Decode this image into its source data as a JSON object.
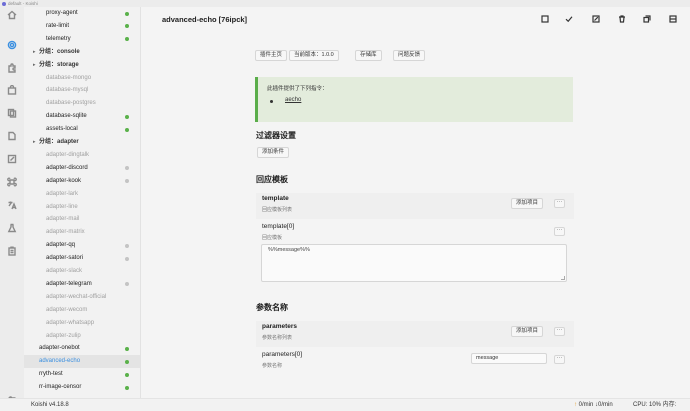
{
  "window": {
    "title": "default - Koishi"
  },
  "statusbar": {
    "version": "Koishi v4.18.8",
    "net_up": "0/min",
    "net_down": "0/min",
    "cpu": "CPU: 10% 内存: 59%"
  },
  "sidebar": {
    "items": [
      {
        "kind": "plugin",
        "label": "proxy-agent",
        "status": "green",
        "disabled": false
      },
      {
        "kind": "plugin",
        "label": "rate-limit",
        "status": "green",
        "disabled": false
      },
      {
        "kind": "plugin",
        "label": "telemetry",
        "status": "green",
        "disabled": false
      },
      {
        "kind": "group",
        "label": "分组：console"
      },
      {
        "kind": "group",
        "label": "分组：storage"
      },
      {
        "kind": "plugin",
        "label": "database-mongo",
        "status": "",
        "disabled": true
      },
      {
        "kind": "plugin",
        "label": "database-mysql",
        "status": "",
        "disabled": true
      },
      {
        "kind": "plugin",
        "label": "database-postgres",
        "status": "",
        "disabled": true
      },
      {
        "kind": "plugin",
        "label": "database-sqlite",
        "status": "green",
        "disabled": false
      },
      {
        "kind": "plugin",
        "label": "assets-local",
        "status": "green",
        "disabled": false
      },
      {
        "kind": "group",
        "label": "分组：adapter"
      },
      {
        "kind": "plugin",
        "label": "adapter-dingtalk",
        "status": "",
        "disabled": true
      },
      {
        "kind": "plugin",
        "label": "adapter-discord",
        "status": "grey",
        "disabled": false
      },
      {
        "kind": "plugin",
        "label": "adapter-kook",
        "status": "grey",
        "disabled": false
      },
      {
        "kind": "plugin",
        "label": "adapter-lark",
        "status": "",
        "disabled": true
      },
      {
        "kind": "plugin",
        "label": "adapter-line",
        "status": "",
        "disabled": true
      },
      {
        "kind": "plugin",
        "label": "adapter-mail",
        "status": "",
        "disabled": true
      },
      {
        "kind": "plugin",
        "label": "adapter-matrix",
        "status": "",
        "disabled": true
      },
      {
        "kind": "plugin",
        "label": "adapter-qq",
        "status": "grey",
        "disabled": false
      },
      {
        "kind": "plugin",
        "label": "adapter-satori",
        "status": "grey",
        "disabled": false
      },
      {
        "kind": "plugin",
        "label": "adapter-slack",
        "status": "",
        "disabled": true
      },
      {
        "kind": "plugin",
        "label": "adapter-telegram",
        "status": "grey",
        "disabled": false
      },
      {
        "kind": "plugin",
        "label": "adapter-wechat-official",
        "status": "",
        "disabled": true
      },
      {
        "kind": "plugin",
        "label": "adapter-wecom",
        "status": "",
        "disabled": true
      },
      {
        "kind": "plugin",
        "label": "adapter-whatsapp",
        "status": "",
        "disabled": true
      },
      {
        "kind": "plugin",
        "label": "adapter-zulip",
        "status": "",
        "disabled": true
      },
      {
        "kind": "plugin",
        "label": "adapter-onebot",
        "status": "green",
        "disabled": false,
        "top": true
      },
      {
        "kind": "plugin",
        "label": "advanced-echo",
        "status": "green",
        "disabled": false,
        "top": true,
        "selected": true
      },
      {
        "kind": "plugin",
        "label": "rryth-test",
        "status": "green",
        "disabled": false,
        "top": true
      },
      {
        "kind": "plugin",
        "label": "rr-image-censor",
        "status": "green",
        "disabled": false,
        "top": true
      }
    ]
  },
  "activity_icons": [
    "home-icon",
    "settings-icon",
    "plugin-icon",
    "market-icon",
    "dependencies-icon",
    "files-icon",
    "edit-icon",
    "command-icon",
    "translate-icon",
    "flask-icon",
    "clipboard-icon",
    "sliders-icon"
  ],
  "main": {
    "title": "advanced-echo [76ipck]",
    "tabs": [
      "插件主页",
      "当前版本：1.0.0",
      "存储库",
      "问题反馈"
    ],
    "notice": {
      "title": "此插件提供了下列指令：",
      "command": "aecho"
    },
    "filter": {
      "title": "过滤器设置",
      "add_condition": "添加条件"
    },
    "reply": {
      "title": "回应模板",
      "template_name": "template",
      "template_desc": "回应模板列表",
      "add_item": "添加项目",
      "template0_name": "template[0]",
      "template0_desc": "回应模板",
      "template0_value": "%%message%%"
    },
    "params": {
      "title": "参数名称",
      "parameters_name": "parameters",
      "parameters_desc": "参数名称列表",
      "add_item": "添加项目",
      "param0_name": "parameters[0]",
      "param0_desc": "参数名称",
      "param0_value": "message"
    },
    "more_label": "···"
  }
}
